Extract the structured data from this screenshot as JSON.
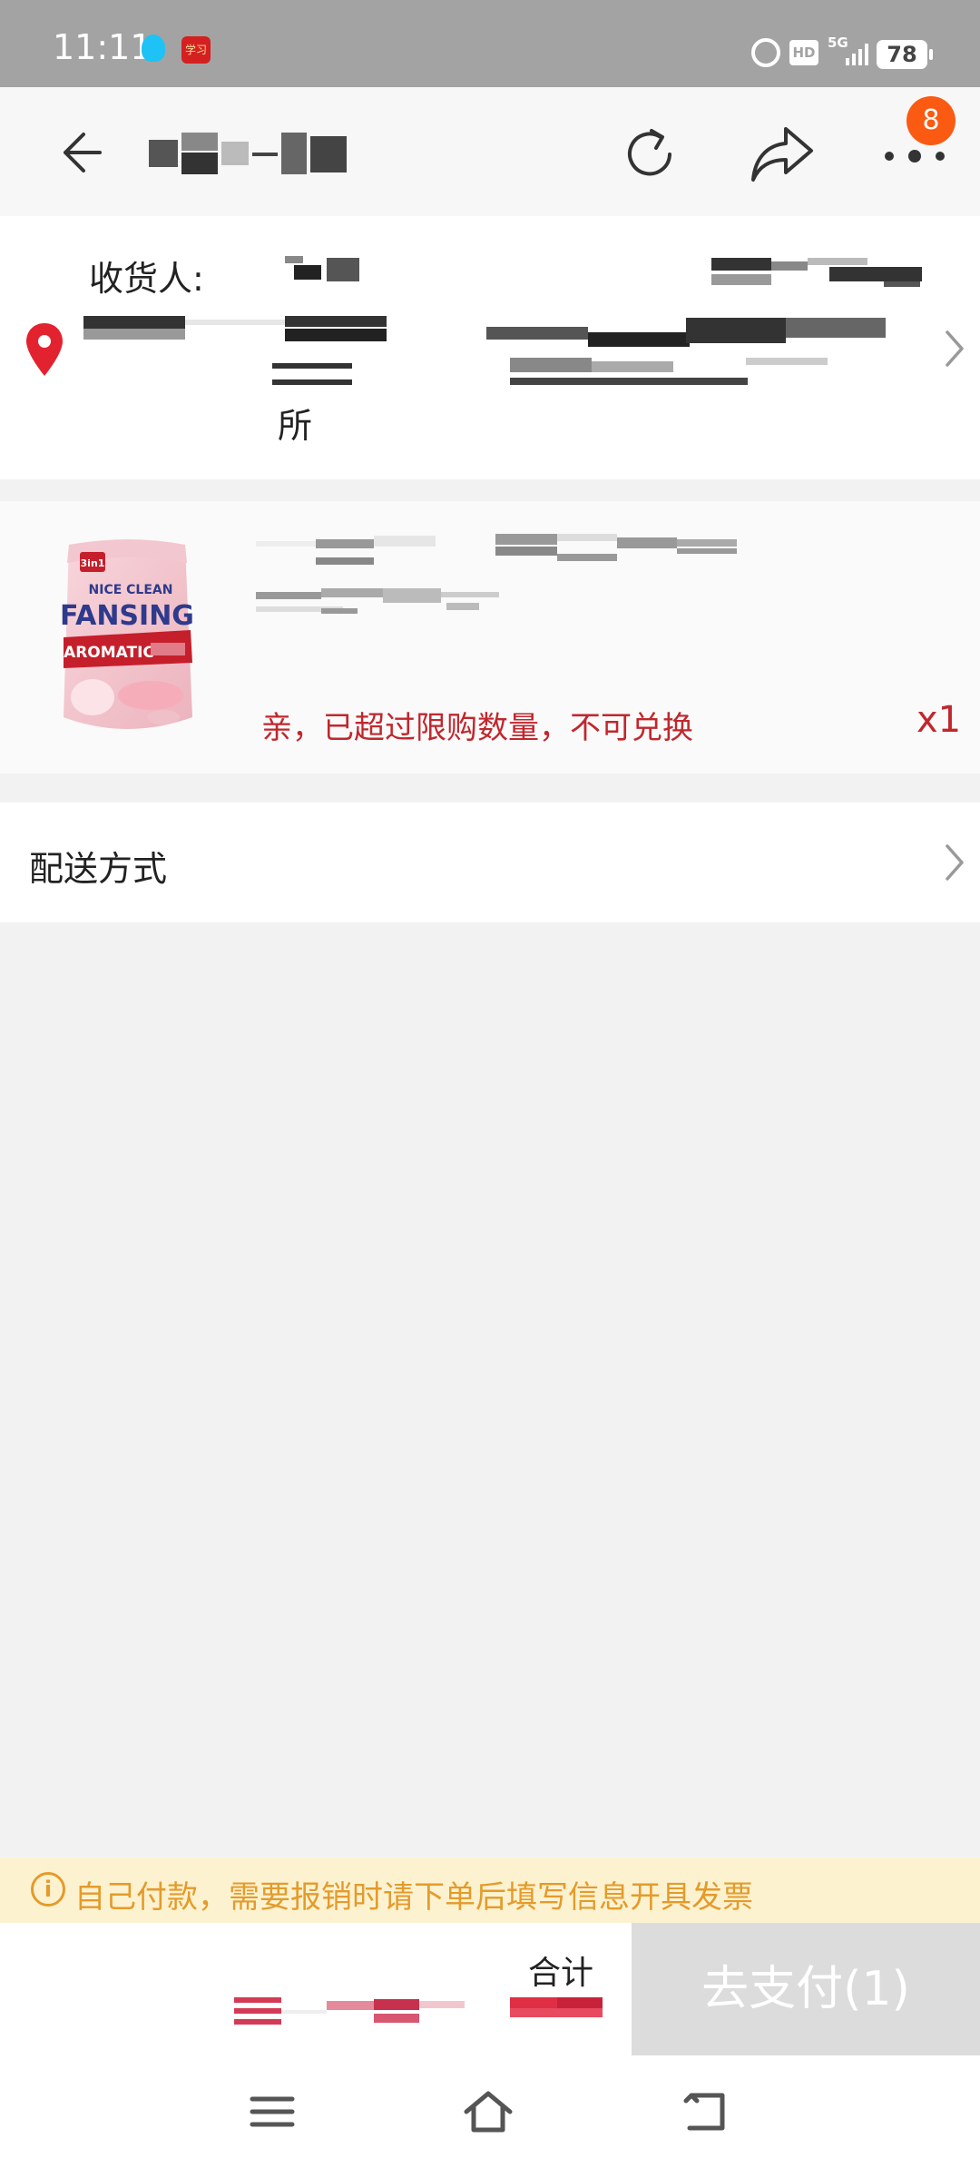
{
  "status_bar": {
    "time": "11:11",
    "app_icon_text": "学习",
    "hd_label": "HD",
    "network": "5G",
    "battery": "78"
  },
  "header": {
    "icons": [
      "back-icon",
      "refresh-icon",
      "share-icon",
      "more-icon"
    ],
    "badge_count": "8"
  },
  "address": {
    "receiver_label": "收货人:",
    "address_tail": "所"
  },
  "product": {
    "limit_notice": "亲，已超过限购数量，不可兑换",
    "quantity": "x1",
    "image_text": {
      "brand_top": "NICE CLEAN",
      "brand": "FANSING",
      "line": "AROMATIC",
      "badge": "3in1"
    }
  },
  "delivery": {
    "label": "配送方式"
  },
  "invoice": {
    "info_symbol": "i",
    "text": "自己付款，需要报销时请下单后填写信息开具发票"
  },
  "bottom_bar": {
    "total_label": "合计",
    "pay_button": "去支付(1)"
  },
  "colors": {
    "accent_red": "#c0272d",
    "badge_orange": "#fa5a12",
    "notice_bg": "#fdf2d0",
    "notice_text": "#e49b2b",
    "pay_button_bg": "#dcdcdc",
    "status_bar_bg": "#a3a3a3"
  }
}
